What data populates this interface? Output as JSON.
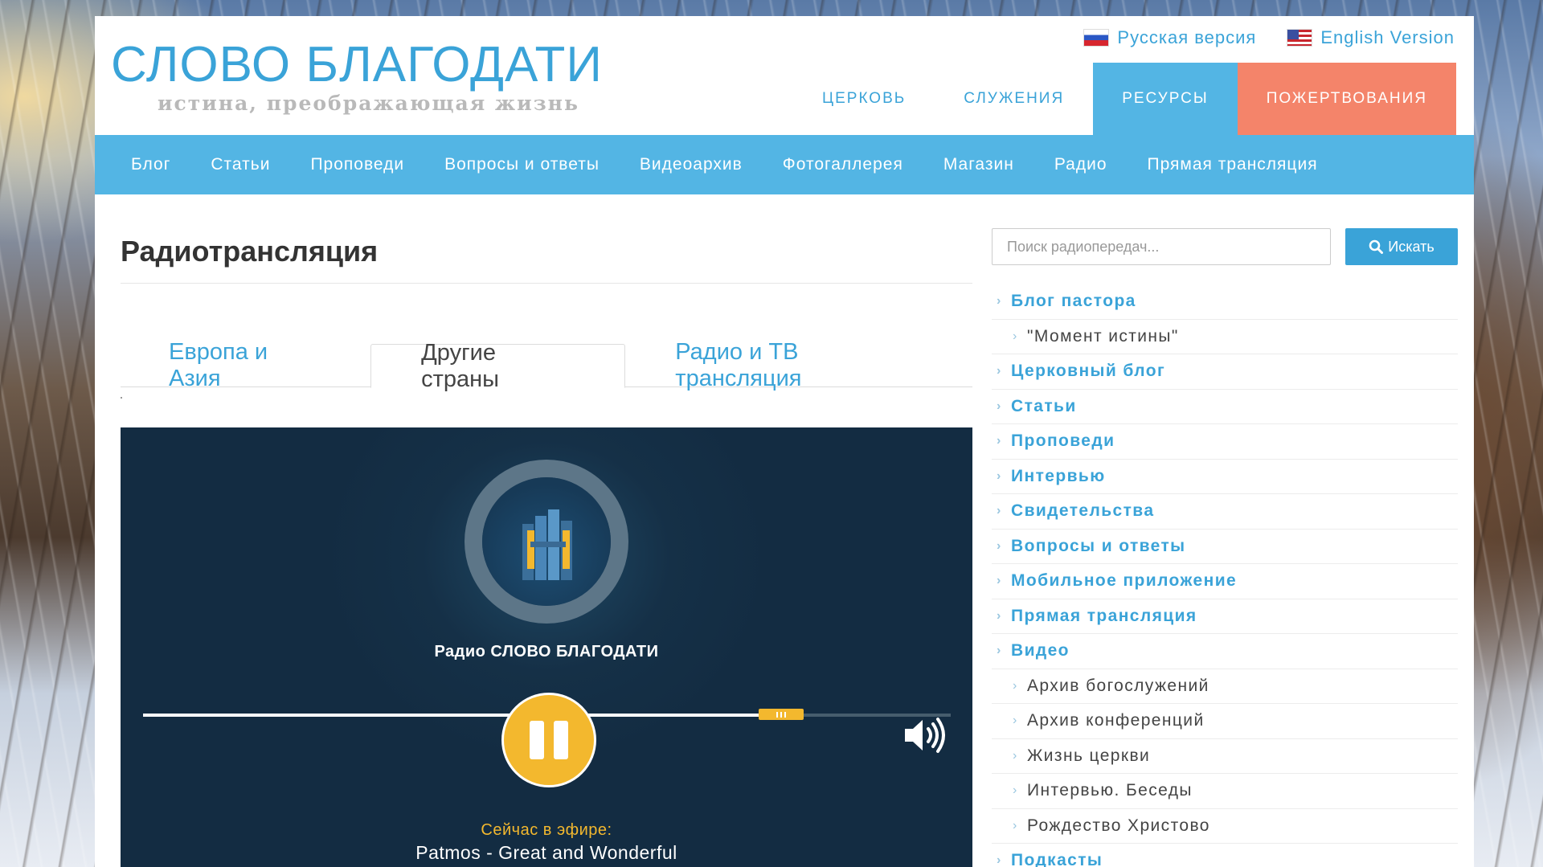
{
  "logo": {
    "title": "СЛОВО БЛАГОДАТИ",
    "subtitle": "истина, преображающая жизнь"
  },
  "lang": {
    "ru": "Русская версия",
    "en": "English Version"
  },
  "topnav": {
    "church": "ЦЕРКОВЬ",
    "ministries": "СЛУЖЕНИЯ",
    "resources": "РЕСУРСЫ",
    "donate": "ПОЖЕРТВОВАНИЯ"
  },
  "subnav": [
    "Блог",
    "Статьи",
    "Проповеди",
    "Вопросы и ответы",
    "Видеоархив",
    "Фотогаллерея",
    "Магазин",
    "Радио",
    "Прямая трансляция"
  ],
  "main": {
    "title": "Радиотрансляция",
    "tabs": [
      "Европа и Азия",
      "Другие страны",
      "Радио и ТВ трансляция"
    ],
    "active_tab": "Другие страны"
  },
  "player": {
    "station": "Радио СЛОВО БЛАГОДАТИ",
    "now_label": "Сейчас в эфире:",
    "now_track": "Patmos - Great and Wonderful",
    "progress_fraction": 0.79,
    "state": "playing"
  },
  "search": {
    "placeholder": "Поиск радиопередач...",
    "button": "Искать"
  },
  "sidebar": [
    {
      "label": "Блог пастора",
      "level": 1
    },
    {
      "label": "\"Момент истины\"",
      "level": 2
    },
    {
      "label": "Церковный блог",
      "level": 1
    },
    {
      "label": "Статьи",
      "level": 1
    },
    {
      "label": "Проповеди",
      "level": 1
    },
    {
      "label": "Интервью",
      "level": 1
    },
    {
      "label": "Свидетельства",
      "level": 1
    },
    {
      "label": "Вопросы и ответы",
      "level": 1
    },
    {
      "label": "Мобильное приложение",
      "level": 1
    },
    {
      "label": "Прямая трансляция",
      "level": 1
    },
    {
      "label": "Видео",
      "level": 1
    },
    {
      "label": "Архив богослужений",
      "level": 2
    },
    {
      "label": "Архив конференций",
      "level": 2
    },
    {
      "label": "Жизнь церкви",
      "level": 2
    },
    {
      "label": "Интервью. Беседы",
      "level": 2
    },
    {
      "label": "Рождество Христово",
      "level": 2
    },
    {
      "label": "Подкасты",
      "level": 1
    }
  ],
  "colors": {
    "accent": "#3aa3d8",
    "nav_bg": "#53b5e4",
    "donate": "#f4846a",
    "player_bg": "#132c42",
    "player_accent": "#f3b82e"
  }
}
